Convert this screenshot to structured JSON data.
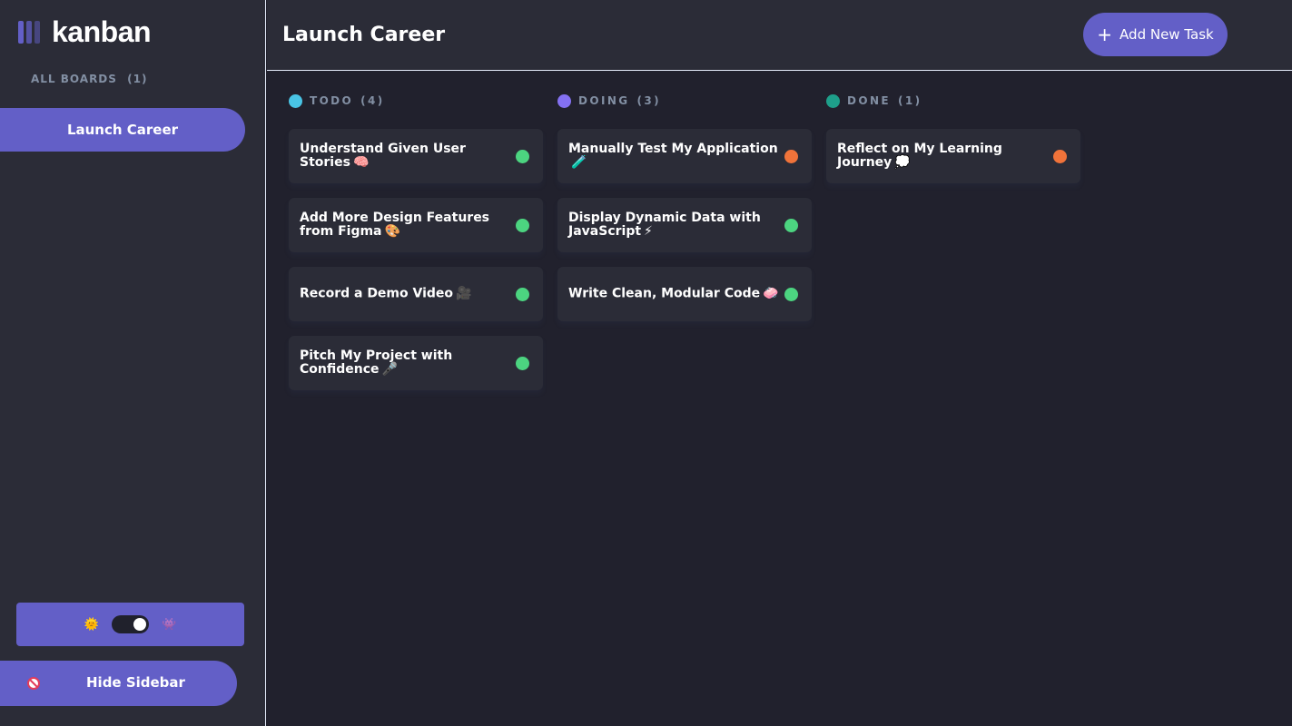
{
  "app": {
    "logo_text": "kanban"
  },
  "sidebar": {
    "all_boards_label": "ALL BOARDS",
    "all_boards_count": "(1)",
    "boards": [
      {
        "label": "Launch Career",
        "active": true
      }
    ],
    "theme": {
      "light_icon": "🌞",
      "dark_icon": "👾",
      "dark_mode_on": true
    },
    "hide_sidebar": {
      "icon": "no-entry-icon",
      "label": "Hide Sidebar"
    }
  },
  "header": {
    "board_title": "Launch Career",
    "add_task_icon": "+",
    "add_task_label": "Add New Task"
  },
  "columns": [
    {
      "name": "TODO",
      "count": "(4)",
      "color": "#49c4e5",
      "cards": [
        {
          "title": "Understand Given User Stories",
          "emoji": "🧠",
          "status_color": "#4cd480"
        },
        {
          "title": "Add More Design Features from Figma",
          "emoji": "🎨",
          "status_color": "#4cd480"
        },
        {
          "title": "Record a Demo Video",
          "emoji": "🎥",
          "status_color": "#4cd480"
        },
        {
          "title": "Pitch My Project with Confidence",
          "emoji": "🎤",
          "status_color": "#4cd480"
        }
      ]
    },
    {
      "name": "DOING",
      "count": "(3)",
      "color": "#8471f2",
      "cards": [
        {
          "title": "Manually Test My Application",
          "emoji": "🧪",
          "status_color": "#f0733a"
        },
        {
          "title": "Display Dynamic Data with JavaScript",
          "emoji": "⚡",
          "status_color": "#4cd480"
        },
        {
          "title": "Write Clean, Modular Code",
          "emoji": "🧼",
          "status_color": "#4cd480"
        }
      ]
    },
    {
      "name": "DONE",
      "count": "(1)",
      "color": "#1e9f8a",
      "cards": [
        {
          "title": "Reflect on My Learning Journey",
          "emoji": "💭",
          "status_color": "#f0733a"
        }
      ]
    }
  ],
  "colors": {
    "accent": "#635fc7",
    "sidebar_bg": "#2b2c37",
    "board_bg": "#21212d",
    "muted_text": "#828fa3",
    "status_green": "#4cd480",
    "status_orange": "#f0733a"
  }
}
